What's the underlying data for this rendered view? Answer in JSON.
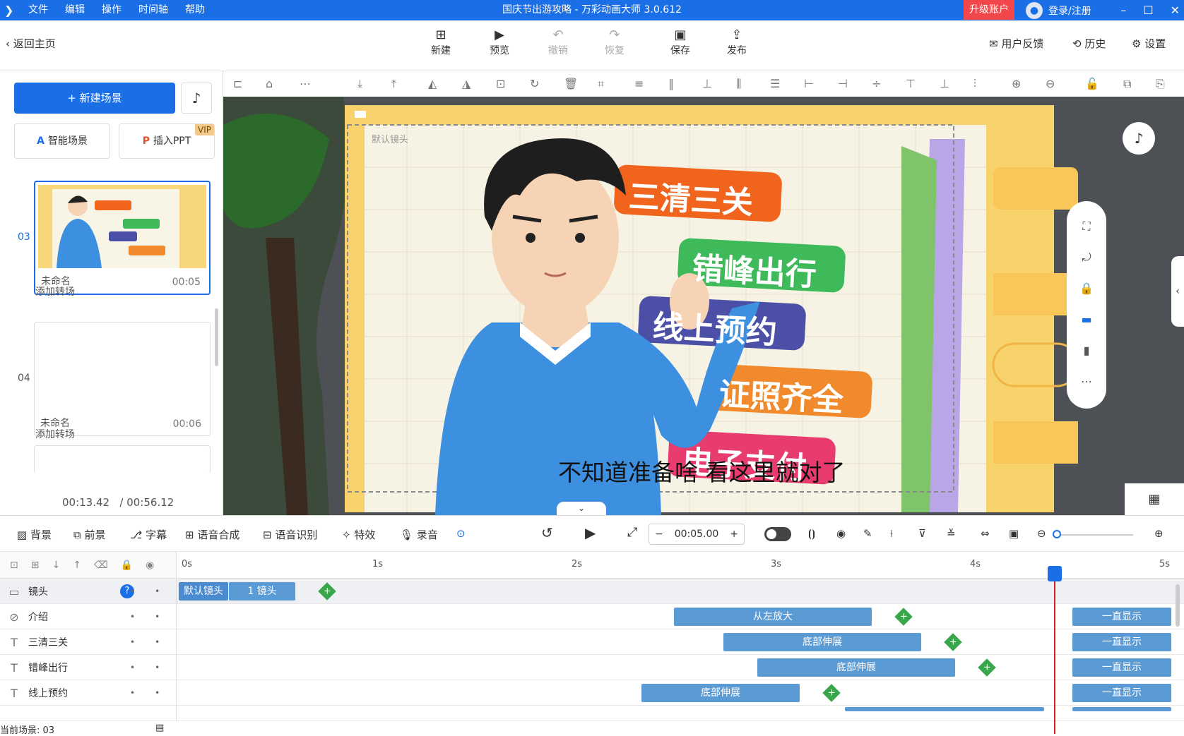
{
  "menubar": {
    "logo": "❯",
    "menu": [
      "文件",
      "编辑",
      "操作",
      "时间轴",
      "帮助"
    ],
    "title": "国庆节出游攻略 - 万彩动画大师 3.0.612",
    "upgrade": "升级账户",
    "login": "登录/注册",
    "win": [
      "–",
      "☐",
      "✕"
    ]
  },
  "toolbar": {
    "back": "返回主页",
    "new": "新建",
    "preview": "预览",
    "undo": "撤销",
    "redo": "恢复",
    "save": "保存",
    "publish": "发布",
    "feedback": "用户反馈",
    "history": "历史",
    "settings": "设置"
  },
  "left": {
    "new_scene": "+ 新建场景",
    "smart_scene": "智能场景",
    "insert_ppt": "插入PPT",
    "vip": "VIP",
    "scenes": [
      {
        "num": "03",
        "name": "未命名",
        "dur": "00:05"
      },
      {
        "num": "04",
        "name": "未命名",
        "dur": "00:06"
      }
    ],
    "add_transition": "添加转场",
    "time_current": "00:13.42",
    "time_total": "/ 00:56.12"
  },
  "canvas": {
    "cam_label": "默认镜头",
    "tags": [
      "三清三关",
      "错峰出行",
      "线上预约",
      "证照齐全",
      "电子支付"
    ],
    "tag_colors": [
      "#f0641e",
      "#3fba5a",
      "#4b4fa6",
      "#f08a2c",
      "#e83c6e"
    ],
    "subtitle": "不知道准备啥 看这里就对了"
  },
  "bottom_toolbar": {
    "items": [
      "背景",
      "前景",
      "字幕",
      "语音合成",
      "语音识别",
      "特效",
      "录音"
    ],
    "time": "00:05.00",
    "minus": "−",
    "plus": "+"
  },
  "timeline": {
    "ticks": [
      "0s",
      "1s",
      "2s",
      "3s",
      "4s",
      "5s"
    ],
    "tracks": [
      {
        "icon": "▭",
        "name": "镜头"
      },
      {
        "icon": "⊘",
        "name": "介绍"
      },
      {
        "icon": "T",
        "name": "三清三关"
      },
      {
        "icon": "T",
        "name": "错峰出行"
      },
      {
        "icon": "T",
        "name": "线上预约"
      }
    ],
    "clips": {
      "cam_default": "默认镜头",
      "cam_1": "1 镜头",
      "intro": "从左放大",
      "expand": "底部伸展",
      "always": "一直显示"
    },
    "help": "?",
    "status": "当前场景: 03"
  }
}
